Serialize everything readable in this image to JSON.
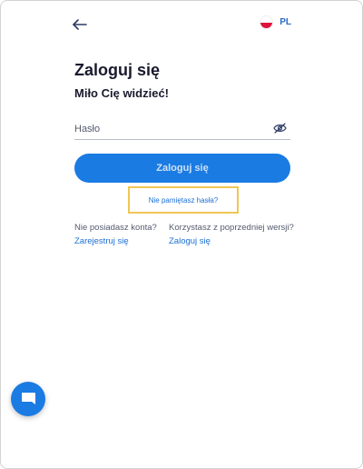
{
  "header": {
    "back_icon": "arrow-left-icon",
    "language_code": "PL",
    "language_flag": "poland-flag-icon"
  },
  "login": {
    "title": "Zaloguj się",
    "subtitle": "Miło Cię widzieć!",
    "password_placeholder": "Hasło",
    "password_value": "",
    "toggle_visibility_icon": "eye-icon",
    "submit_label": "Zaloguj się",
    "forgot_password_label": "Nie pamiętasz hasła?"
  },
  "footer_links": {
    "no_account_text": "Nie posiadasz konta?",
    "register_label": "Zarejestruj się",
    "old_version_text": "Korzystasz z poprzedniej wersji?",
    "old_login_label": "Zaloguj się"
  },
  "chat": {
    "icon": "chat-icon"
  },
  "colors": {
    "primary": "#1a7be3",
    "link": "#1a6fd6",
    "highlight_border": "#f0c654",
    "text_dark": "#1a1a2e"
  }
}
